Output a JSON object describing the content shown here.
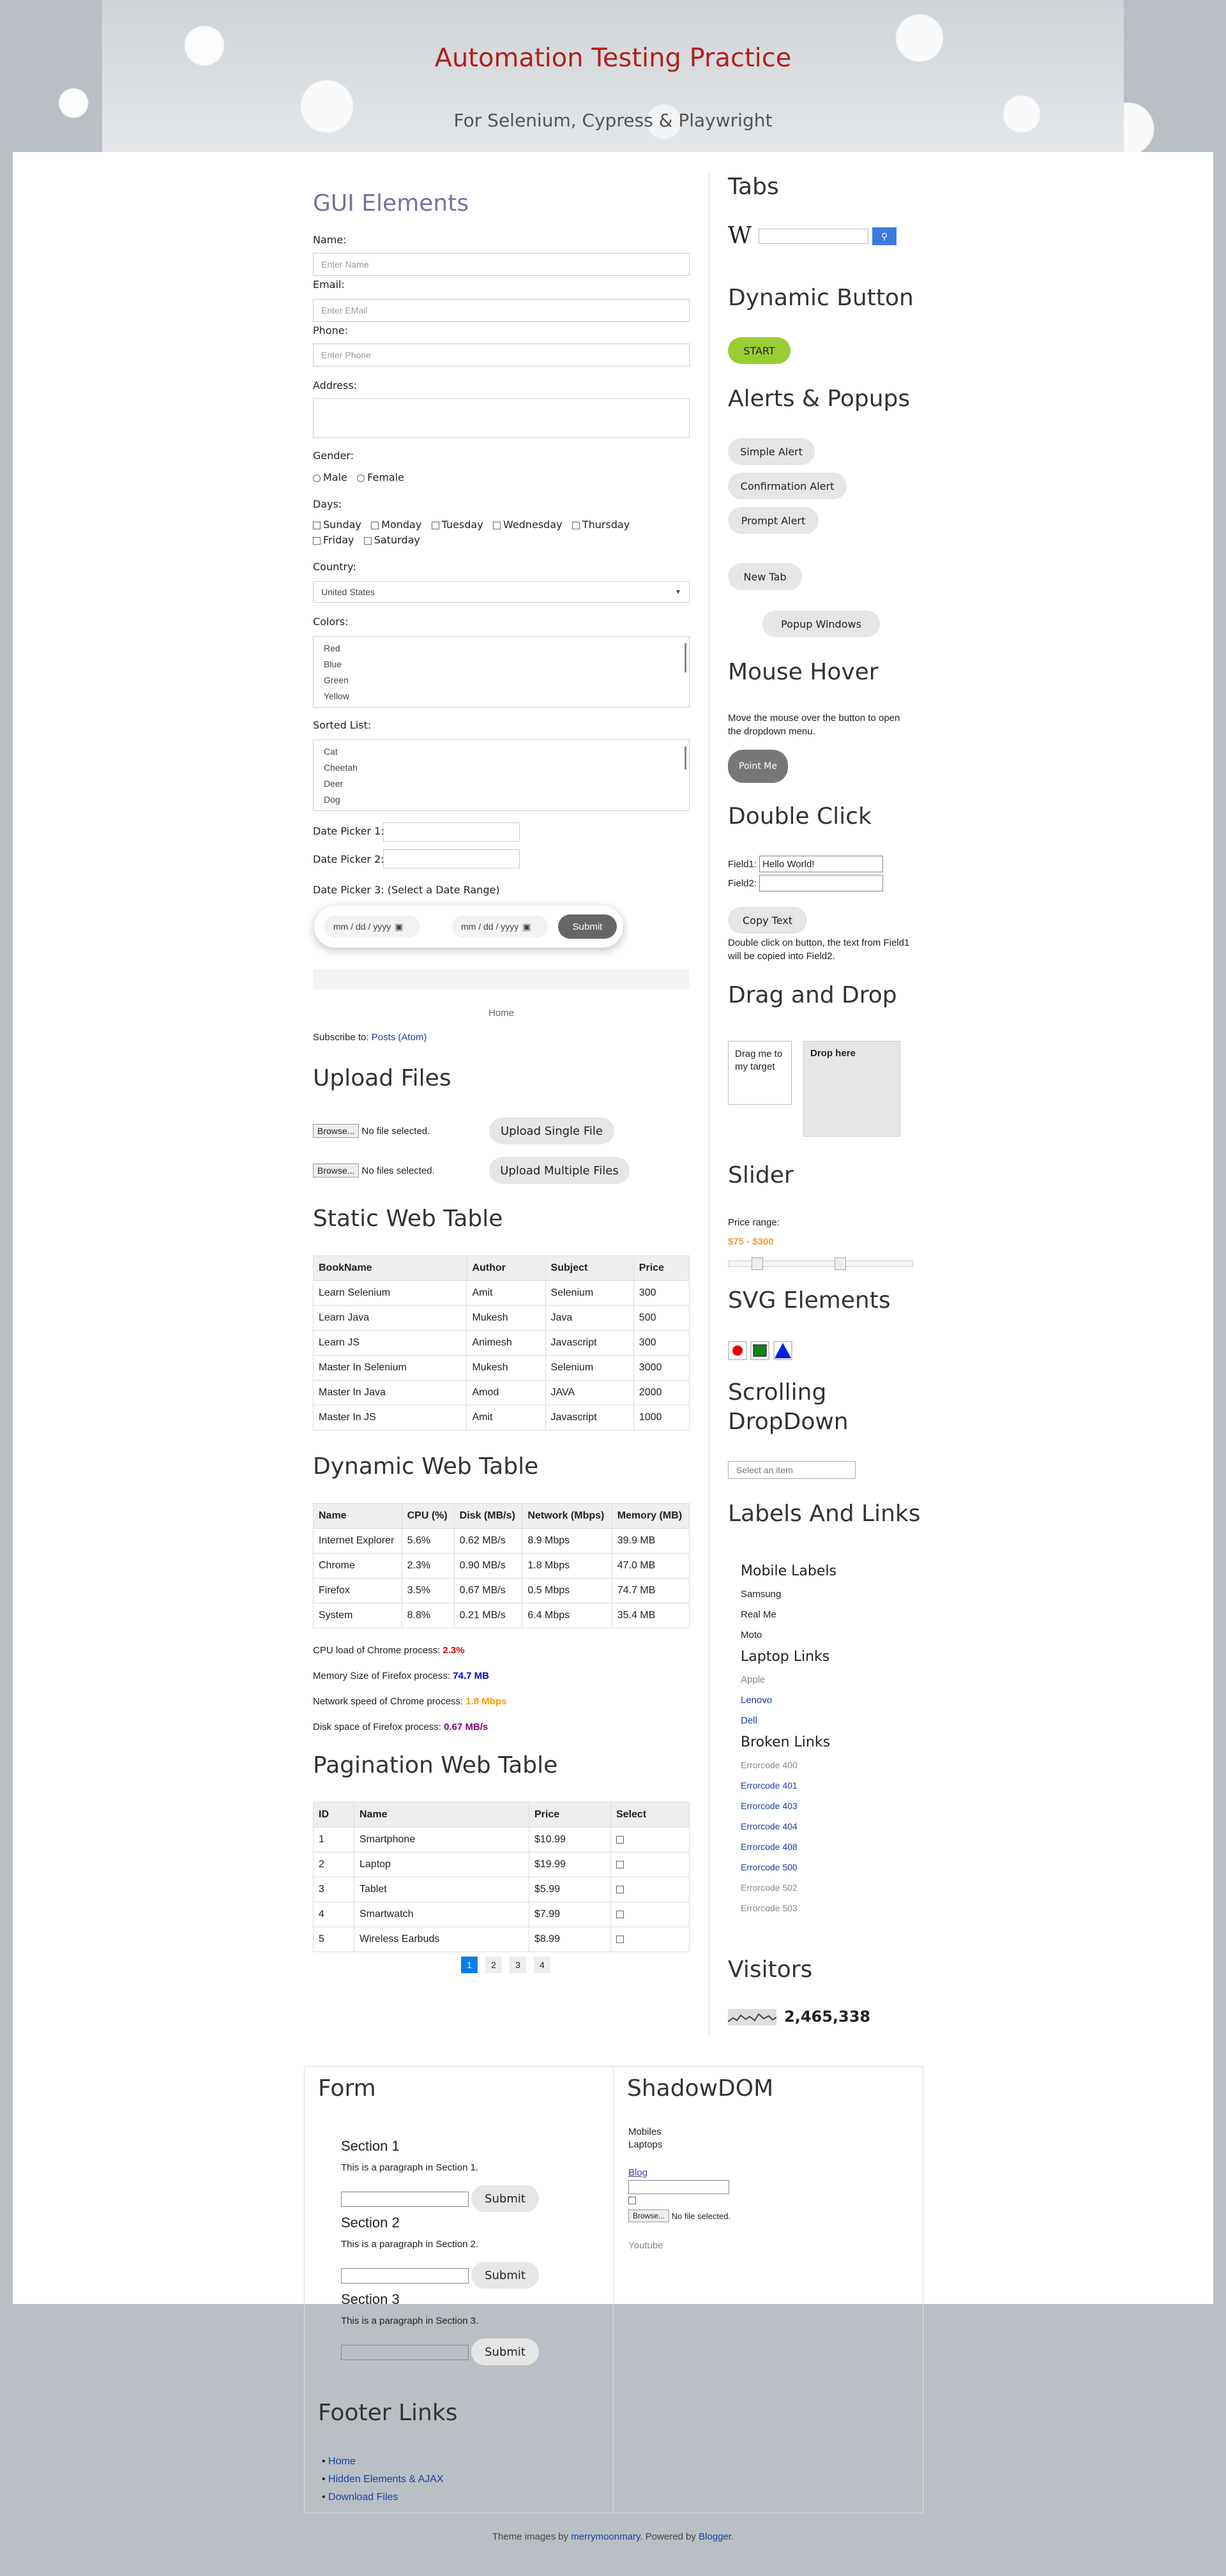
{
  "header": {
    "title": "Automation Testing Practice",
    "description": "For Selenium, Cypress & Playwright"
  },
  "gui": {
    "title": "GUI Elements",
    "name_label": "Name:",
    "name_ph": "Enter Name",
    "email_label": "Email:",
    "email_ph": "Enter EMail",
    "phone_label": "Phone:",
    "phone_ph": "Enter Phone",
    "address_label": "Address:",
    "gender_label": "Gender:",
    "male": "Male",
    "female": "Female",
    "days_label": "Days:",
    "days": [
      "Sunday",
      "Monday",
      "Tuesday",
      "Wednesday",
      "Thursday",
      "Friday",
      "Saturday"
    ],
    "country_label": "Country:",
    "country_value": "United States",
    "colors_label": "Colors:",
    "colors": [
      "Red",
      "Blue",
      "Green",
      "Yellow"
    ],
    "sorted_label": "Sorted List:",
    "animals": [
      "Cat",
      "Cheetah",
      "Deer",
      "Dog"
    ],
    "dp1": "Date Picker 1:",
    "dp2": "Date Picker 2:",
    "dp3": "Date Picker 3: (Select a Date Range)",
    "date_ph": "mm / dd / yyyy",
    "submit": "Submit",
    "home": "Home",
    "subscribe": "Subscribe to:",
    "posts": "Posts (Atom)"
  },
  "upload": {
    "title": "Upload Files",
    "browse": "Browse...",
    "no_file": "No file selected.",
    "no_files": "No files selected.",
    "single": "Upload Single File",
    "multiple": "Upload Multiple Files"
  },
  "static_table": {
    "title": "Static Web Table",
    "headers": [
      "BookName",
      "Author",
      "Subject",
      "Price"
    ],
    "rows": [
      [
        "Learn Selenium",
        "Amit",
        "Selenium",
        "300"
      ],
      [
        "Learn Java",
        "Mukesh",
        "Java",
        "500"
      ],
      [
        "Learn JS",
        "Animesh",
        "Javascript",
        "300"
      ],
      [
        "Master In Selenium",
        "Mukesh",
        "Selenium",
        "3000"
      ],
      [
        "Master In Java",
        "Amod",
        "JAVA",
        "2000"
      ],
      [
        "Master In JS",
        "Amit",
        "Javascript",
        "1000"
      ]
    ]
  },
  "dynamic_table": {
    "title": "Dynamic Web Table",
    "headers": [
      "Name",
      "CPU (%)",
      "Disk (MB/s)",
      "Network (Mbps)",
      "Memory (MB)"
    ],
    "rows": [
      [
        "Internet Explorer",
        "5.6%",
        "0.62 MB/s",
        "8.9 Mbps",
        "39.9 MB"
      ],
      [
        "Chrome",
        "2.3%",
        "0.90 MB/s",
        "1.8 Mbps",
        "47.0 MB"
      ],
      [
        "Firefox",
        "3.5%",
        "0.67 MB/s",
        "0.5 Mbps",
        "74.7 MB"
      ],
      [
        "System",
        "8.8%",
        "0.21 MB/s",
        "6.4 Mbps",
        "35.4 MB"
      ]
    ],
    "stats": [
      {
        "label": "CPU load of Chrome process:",
        "value": "2.3%",
        "color": "#e60000"
      },
      {
        "label": "Memory Size of Firefox process:",
        "value": "74.7 MB",
        "color": "#0000cc"
      },
      {
        "label": "Network speed of Chrome process:",
        "value": "1.8 Mbps",
        "color": "#f0a000"
      },
      {
        "label": "Disk space of Firefox process:",
        "value": "0.67 MB/s",
        "color": "#800080"
      }
    ]
  },
  "pagination": {
    "title": "Pagination Web Table",
    "headers": [
      "ID",
      "Name",
      "Price",
      "Select"
    ],
    "rows": [
      [
        "1",
        "Smartphone",
        "$10.99"
      ],
      [
        "2",
        "Laptop",
        "$19.99"
      ],
      [
        "3",
        "Tablet",
        "$5.99"
      ],
      [
        "4",
        "Smartwatch",
        "$7.99"
      ],
      [
        "5",
        "Wireless Earbuds",
        "$8.99"
      ]
    ],
    "pages": [
      "1",
      "2",
      "3",
      "4"
    ],
    "active_color": "#0a7ee8"
  },
  "side": {
    "tabs": "Tabs",
    "dynamic_button": "Dynamic Button",
    "start": "START",
    "alerts": "Alerts & Popups",
    "simple": "Simple Alert",
    "confirm": "Confirmation Alert",
    "prompt": "Prompt Alert",
    "new_tab": "New Tab",
    "popup": "Popup Windows",
    "mouse_hover": "Mouse Hover",
    "hover_text": "Move the mouse over the button to open the dropdown menu.",
    "point_me": "Point Me",
    "double_click": "Double Click",
    "field1_label": "Field1:",
    "field1_value": "Hello World!",
    "field2_label": "Field2:",
    "copy_text": "Copy Text",
    "dbl_text": "Double click on button, the text from Field1 will be copied into Field2.",
    "drag_drop": "Drag and Drop",
    "drag_me": "Drag me to my target",
    "drop_here": "Drop here",
    "slider": "Slider",
    "price_range": "Price range:",
    "price_value": "$75 - $300",
    "svg": "SVG Elements",
    "scrolling": "Scrolling DropDown",
    "select_ph": "Select an item",
    "labels_links": "Labels And Links",
    "mobile_labels": "Mobile Labels",
    "mobiles": [
      "Samsung",
      "Real Me",
      "Moto"
    ],
    "laptop_links": "Laptop Links",
    "laptops": [
      "Apple",
      "Lenovo",
      "Dell"
    ],
    "broken_links": "Broken Links",
    "errors": [
      "Errorcode 400",
      "Errorcode 401",
      "Errorcode 403",
      "Errorcode 404",
      "Errorcode 408",
      "Errorcode 500",
      "Errorcode 502",
      "Errorcode 503"
    ],
    "visitors": "Visitors",
    "visitor_count": "2,465,338",
    "accent": "#9acd32"
  },
  "bottom": {
    "form": "Form",
    "sections": [
      {
        "title": "Section 1",
        "text": "This is a paragraph in Section 1."
      },
      {
        "title": "Section 2",
        "text": "This is a paragraph in Section 2."
      },
      {
        "title": "Section 3",
        "text": "This is a paragraph in Section 3."
      }
    ],
    "submit": "Submit",
    "shadow": "ShadowDOM",
    "mobiles": "Mobiles",
    "laptops": "Laptops",
    "blog": "Blog",
    "youtube": "Youtube",
    "browse": "Browse...",
    "no_file": "No file selected.",
    "footer_links": "Footer Links",
    "footer_items": [
      "Home",
      "Hidden Elements & AJAX",
      "Download Files"
    ]
  },
  "footer": {
    "prefix": "Theme images by",
    "author": "merrymoonmary",
    "mid": ". Powered by",
    "blogger": "Blogger",
    "suffix": "."
  }
}
